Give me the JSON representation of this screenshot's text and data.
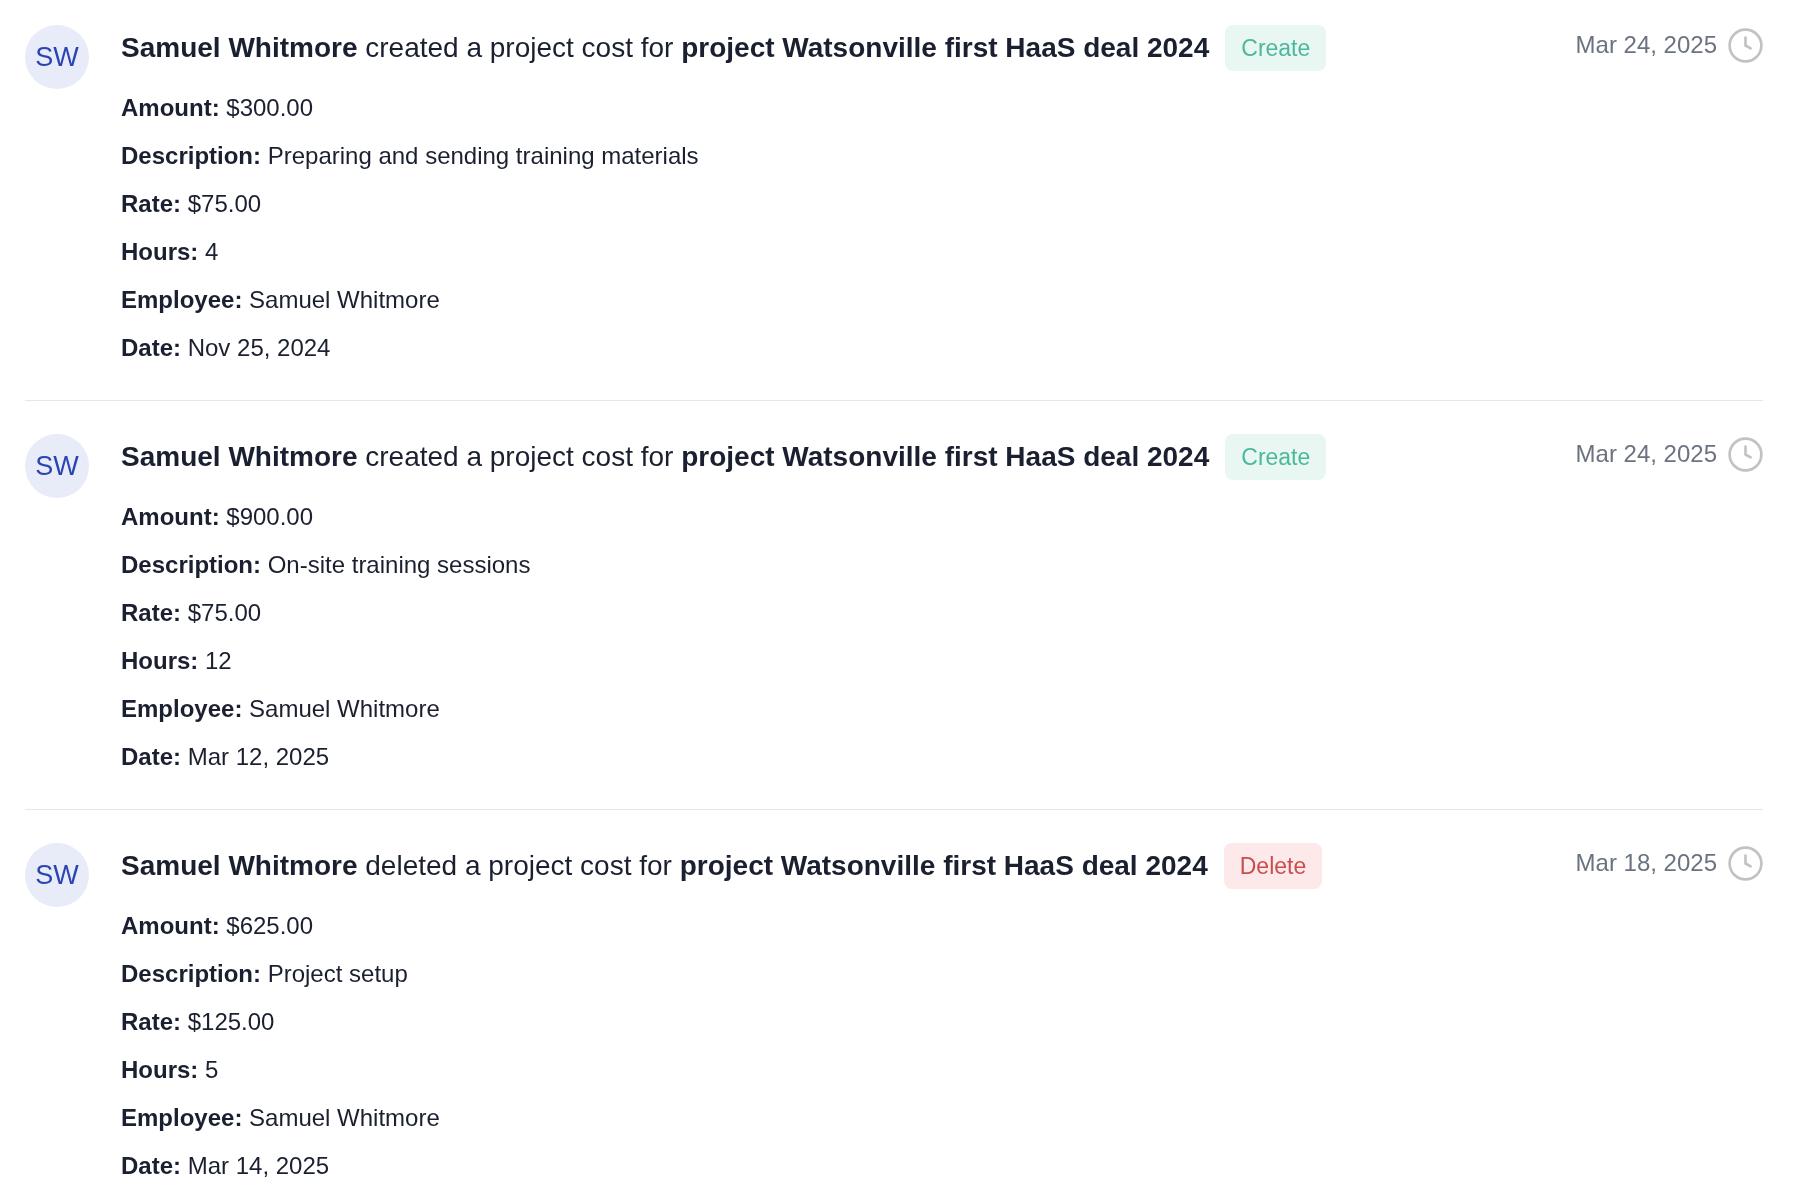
{
  "activity": [
    {
      "avatar": {
        "initials": "SW"
      },
      "headline": "**Samuel Whitmore** created a project cost for **project Watsonville first HaaS deal 2024**",
      "badge": {
        "label": "Create",
        "kind": "create"
      },
      "date": "Mar 24, 2025",
      "details": [
        {
          "label": "Amount:",
          "value": "$300.00"
        },
        {
          "label": "Description:",
          "value": "Preparing and sending training materials"
        },
        {
          "label": "Rate:",
          "value": "$75.00"
        },
        {
          "label": "Hours:",
          "value": "4"
        },
        {
          "label": "Employee:",
          "value": "Samuel Whitmore"
        },
        {
          "label": "Date:",
          "value": "Nov 25, 2024"
        }
      ]
    },
    {
      "avatar": {
        "initials": "SW"
      },
      "headline": "**Samuel Whitmore** created a project cost for **project Watsonville first HaaS deal 2024**",
      "badge": {
        "label": "Create",
        "kind": "create"
      },
      "date": "Mar 24, 2025",
      "details": [
        {
          "label": "Amount:",
          "value": "$900.00"
        },
        {
          "label": "Description:",
          "value": "On-site training sessions"
        },
        {
          "label": "Rate:",
          "value": "$75.00"
        },
        {
          "label": "Hours:",
          "value": "12"
        },
        {
          "label": "Employee:",
          "value": "Samuel Whitmore"
        },
        {
          "label": "Date:",
          "value": "Mar 12, 2025"
        }
      ]
    },
    {
      "avatar": {
        "initials": "SW"
      },
      "headline": "**Samuel Whitmore** deleted a project cost for **project Watsonville first HaaS deal 2024**",
      "badge": {
        "label": "Delete",
        "kind": "delete"
      },
      "date": "Mar 18, 2025",
      "details": [
        {
          "label": "Amount:",
          "value": "$625.00"
        },
        {
          "label": "Description:",
          "value": "Project setup"
        },
        {
          "label": "Rate:",
          "value": "$125.00"
        },
        {
          "label": "Hours:",
          "value": "5"
        },
        {
          "label": "Employee:",
          "value": "Samuel Whitmore"
        },
        {
          "label": "Date:",
          "value": "Mar 14, 2025"
        }
      ]
    }
  ]
}
